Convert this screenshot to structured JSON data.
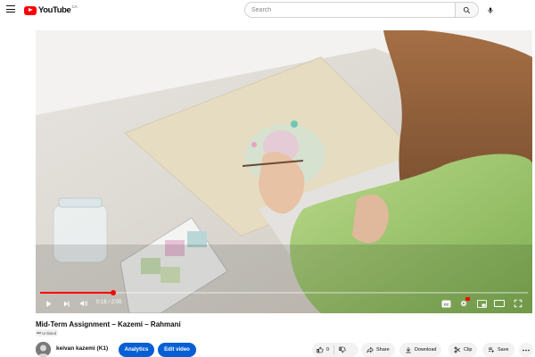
{
  "header": {
    "logo_text": "YouTube",
    "logo_region": "CA",
    "search_placeholder": "Search"
  },
  "video": {
    "current_time": "0:18",
    "duration": "2:00",
    "progress_fraction": 0.15,
    "time_display": "0:18 / 2:00"
  },
  "info": {
    "title": "Mid-Term Assignment – Kazemi – Rahmani",
    "visibility": "Unlisted",
    "channel_name": "keivan kazemi (K1)"
  },
  "actions": {
    "analytics_label": "Analytics",
    "edit_label": "Edit video",
    "like_count": "0",
    "share_label": "Share",
    "download_label": "Download",
    "clip_label": "Clip",
    "save_label": "Save"
  },
  "colors": {
    "brand_red": "#ff0000",
    "action_blue": "#065fd4",
    "pill_grey": "#f2f2f2"
  }
}
